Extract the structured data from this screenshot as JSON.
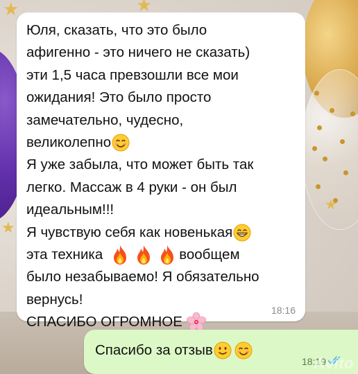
{
  "conversation": {
    "incoming": {
      "lines": [
        "Юля, сказать, что это было",
        "афигенно - это ничего не сказать)",
        "эти 1,5 часа превзошли все мои",
        "ожидания! Это было просто",
        "замечательно,  чудесно,",
        "великолепно",
        "Я уже забыла, что может быть так",
        "легко. Массаж в 4 руки - он был",
        "идеальным!!!",
        "Я чувствую себя как новенькая",
        "эта техника",
        "вообщем",
        "было незабываемо! Я обязательно",
        "вернусь!",
        "СПАСИБО ОГРОМНОЕ"
      ],
      "time": "18:16"
    },
    "outgoing": {
      "text": "Спасибо за отзыв",
      "time": "18:19"
    }
  },
  "watermark": "Avito",
  "icons": {
    "smile": "smiling-face-icon",
    "grin": "grinning-face-icon",
    "fire": "fire-icon",
    "flower": "cherry-blossom-icon",
    "ticks": "double-check-icon"
  },
  "colors": {
    "incoming_bubble": "#ffffff",
    "outgoing_bubble": "#dcf8c6",
    "read_ticks": "#4fb6ec"
  }
}
